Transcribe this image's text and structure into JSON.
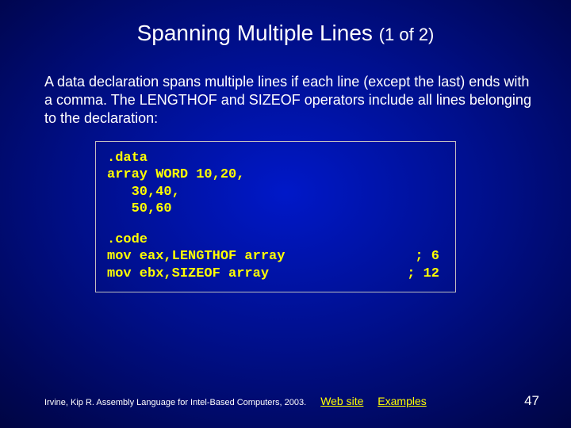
{
  "title_main": "Spanning Multiple Lines ",
  "title_sub": "(1 of 2)",
  "body_text": "A data declaration spans multiple lines if each line (except the last) ends with a comma. The LENGTHOF and SIZEOF operators include all lines belonging to the declaration:",
  "code": {
    "block1": ".data\narray WORD 10,20,\n   30,40,\n   50,60",
    "line_code_1": ".code",
    "line_code_2_left": "mov eax,LENGTHOF array",
    "line_code_2_comment": "; 6 ",
    "line_code_3_left": "mov ebx,SIZEOF array",
    "line_code_3_comment": "; 12"
  },
  "footer": {
    "citation": "Irvine, Kip R. Assembly Language for Intel-Based Computers, 2003.",
    "link1": "Web site",
    "link2": "Examples",
    "page": "47"
  }
}
